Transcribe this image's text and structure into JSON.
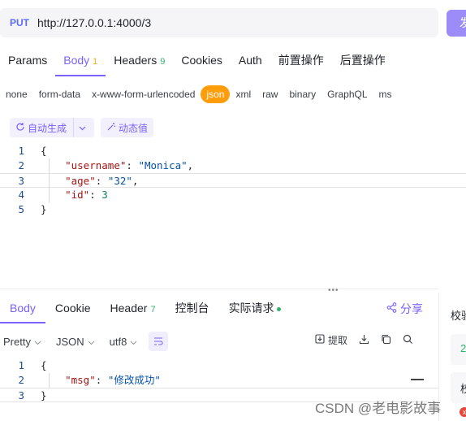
{
  "request": {
    "method": "PUT",
    "url": "http://127.0.0.1:4000/3",
    "send_label": "发"
  },
  "req_tabs": [
    {
      "label": "Params"
    },
    {
      "label": "Body",
      "badge": "1"
    },
    {
      "label": "Headers",
      "badge": "9"
    },
    {
      "label": "Cookies"
    },
    {
      "label": "Auth"
    },
    {
      "label": "前置操作"
    },
    {
      "label": "后置操作"
    }
  ],
  "body_types": [
    "none",
    "form-data",
    "x-www-form-urlencoded",
    "json",
    "xml",
    "raw",
    "binary",
    "GraphQL",
    "ms"
  ],
  "generator": {
    "auto_label": "自动生成",
    "dynamic_label": "动态值"
  },
  "request_body": {
    "line_numbers": [
      "1",
      "2",
      "3",
      "4",
      "5"
    ],
    "open_brace": "{",
    "username_key": "\"username\"",
    "username_val": "\"Monica\"",
    "age_key": "\"age\"",
    "age_val": "\"32\"",
    "id_key": "\"id\"",
    "id_val": "3",
    "close_brace": "}",
    "colon": ": ",
    "comma": ","
  },
  "resp_tabs": [
    {
      "label": "Body"
    },
    {
      "label": "Cookie"
    },
    {
      "label": "Header",
      "badge": "7"
    },
    {
      "label": "控制台"
    },
    {
      "label": "实际请求"
    }
  ],
  "share_label": "分享",
  "resp_tools": {
    "format": "Pretty",
    "type": "JSON",
    "encoding": "utf8",
    "extract_label": "提取"
  },
  "response_body": {
    "line_numbers": [
      "1",
      "2",
      "3"
    ],
    "open_brace": "{",
    "msg_key": "\"msg\"",
    "msg_val": "\"修改成功\"",
    "close_brace": "}",
    "colon": ": "
  },
  "right_panel": {
    "label": "校验",
    "card1": "2",
    "card2": "校",
    "error": "x"
  },
  "watermark": "CSDN @老电影故事",
  "colors": {
    "accent": "#7b61ff",
    "json_active": "#ff9d0a",
    "success": "#2fb36d"
  }
}
